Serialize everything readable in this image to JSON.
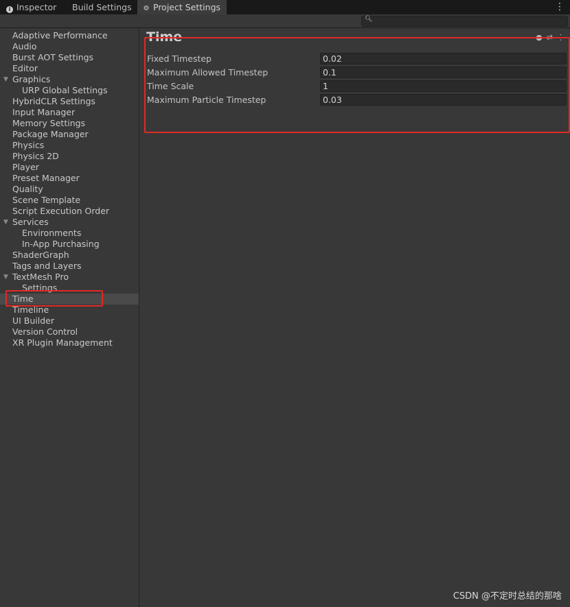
{
  "tabs": [
    {
      "label": "Inspector",
      "icon": "info-icon"
    },
    {
      "label": "Build Settings"
    },
    {
      "label": "Project Settings",
      "icon": "gear-icon",
      "active": true
    }
  ],
  "search": {
    "placeholder": "",
    "value": ""
  },
  "sidebar": {
    "items": [
      {
        "label": "Adaptive Performance",
        "depth": 0
      },
      {
        "label": "Audio",
        "depth": 0
      },
      {
        "label": "Burst AOT Settings",
        "depth": 0
      },
      {
        "label": "Editor",
        "depth": 0
      },
      {
        "label": "Graphics",
        "depth": 0,
        "expanded": true
      },
      {
        "label": "URP Global Settings",
        "depth": 1
      },
      {
        "label": "HybridCLR Settings",
        "depth": 0
      },
      {
        "label": "Input Manager",
        "depth": 0
      },
      {
        "label": "Memory Settings",
        "depth": 0
      },
      {
        "label": "Package Manager",
        "depth": 0
      },
      {
        "label": "Physics",
        "depth": 0
      },
      {
        "label": "Physics 2D",
        "depth": 0
      },
      {
        "label": "Player",
        "depth": 0
      },
      {
        "label": "Preset Manager",
        "depth": 0
      },
      {
        "label": "Quality",
        "depth": 0
      },
      {
        "label": "Scene Template",
        "depth": 0
      },
      {
        "label": "Script Execution Order",
        "depth": 0
      },
      {
        "label": "Services",
        "depth": 0,
        "expanded": true
      },
      {
        "label": "Environments",
        "depth": 1
      },
      {
        "label": "In-App Purchasing",
        "depth": 1
      },
      {
        "label": "ShaderGraph",
        "depth": 0
      },
      {
        "label": "Tags and Layers",
        "depth": 0
      },
      {
        "label": "TextMesh Pro",
        "depth": 0,
        "expanded": true
      },
      {
        "label": "Settings",
        "depth": 1
      },
      {
        "label": "Time",
        "depth": 0,
        "selected": true
      },
      {
        "label": "Timeline",
        "depth": 0
      },
      {
        "label": "UI Builder",
        "depth": 0
      },
      {
        "label": "Version Control",
        "depth": 0
      },
      {
        "label": "XR Plugin Management",
        "depth": 0
      }
    ]
  },
  "main": {
    "title": "Time",
    "fields": [
      {
        "label": "Fixed Timestep",
        "value": "0.02"
      },
      {
        "label": "Maximum Allowed Timestep",
        "value": "0.1"
      },
      {
        "label": "Time Scale",
        "value": "1"
      },
      {
        "label": "Maximum Particle Timestep",
        "value": "0.03"
      }
    ]
  },
  "watermark": "CSDN @不定时总结的那啥",
  "colors": {
    "annotation": "#e02a25",
    "panel": "#383838",
    "field": "#2a2a2a"
  }
}
